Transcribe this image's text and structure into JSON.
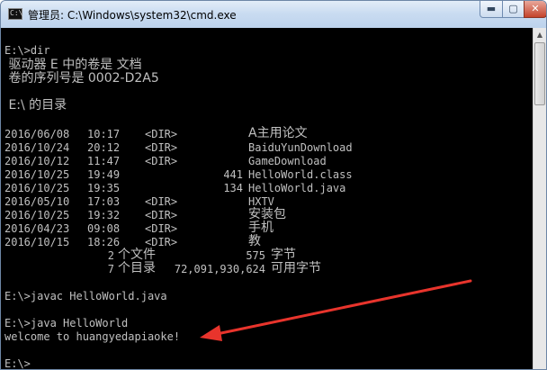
{
  "window": {
    "title": "管理员: C:\\Windows\\system32\\cmd.exe",
    "icon": "console-icon",
    "controls": {
      "minimize": "▬",
      "maximize": "▢",
      "close": "✕"
    }
  },
  "console": {
    "text_color": "#c0c0c0",
    "background": "#000000",
    "cmd_dir": "E:\\>dir",
    "volume_line1": " 驱动器 E 中的卷是 文档",
    "volume_line2": " 卷的序列号是 0002-D2A5",
    "dir_of": " E:\\ 的目录",
    "entries": [
      {
        "date": "2016/06/08",
        "time": "10:17",
        "type": "<DIR>",
        "size": "",
        "name": "A主用论文"
      },
      {
        "date": "2016/10/24",
        "time": "20:12",
        "type": "<DIR>",
        "size": "",
        "name": "BaiduYunDownload"
      },
      {
        "date": "2016/10/12",
        "time": "11:47",
        "type": "<DIR>",
        "size": "",
        "name": "GameDownload"
      },
      {
        "date": "2016/10/25",
        "time": "19:49",
        "type": "",
        "size": "441",
        "name": "HelloWorld.class"
      },
      {
        "date": "2016/10/25",
        "time": "19:35",
        "type": "",
        "size": "134",
        "name": "HelloWorld.java"
      },
      {
        "date": "2016/05/10",
        "time": "17:03",
        "type": "<DIR>",
        "size": "",
        "name": "HXTV"
      },
      {
        "date": "2016/10/25",
        "time": "19:32",
        "type": "<DIR>",
        "size": "",
        "name": "安装包"
      },
      {
        "date": "2016/04/23",
        "time": "09:08",
        "type": "<DIR>",
        "size": "",
        "name": "手机"
      },
      {
        "date": "2016/10/15",
        "time": "18:26",
        "type": "<DIR>",
        "size": "",
        "name": "教"
      }
    ],
    "files_summary": {
      "count": "2",
      "label1": "个文件",
      "bytes": "575",
      "label2": "字节"
    },
    "dirs_summary": {
      "count": "7",
      "label1": "个目录",
      "bytes": "72,091,930,624",
      "label2": "可用字节"
    },
    "cmd_javac": "E:\\>javac HelloWorld.java",
    "cmd_java": "E:\\>java HelloWorld",
    "program_output": "welcome to huangyedapiaoke!",
    "prompt": "E:\\>"
  },
  "annotation": {
    "arrow_color": "#e8342c"
  }
}
